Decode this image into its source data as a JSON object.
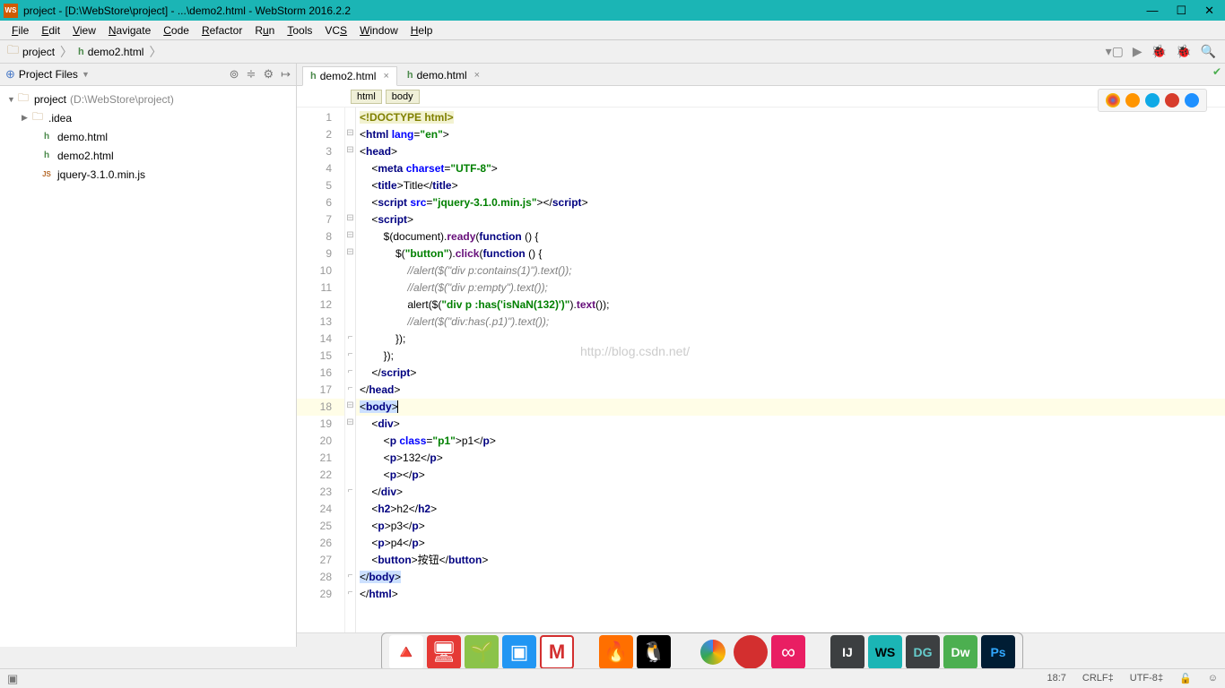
{
  "titlebar": {
    "text": "project - [D:\\WebStore\\project] - ...\\demo2.html - WebStorm 2016.2.2"
  },
  "menus": [
    "File",
    "Edit",
    "View",
    "Navigate",
    "Code",
    "Refactor",
    "Run",
    "Tools",
    "VCS",
    "Window",
    "Help"
  ],
  "breadcrumb": {
    "folder": "project",
    "file": "demo2.html"
  },
  "project_panel": {
    "title": "Project Files",
    "root": "project",
    "root_path": "(D:\\WebStore\\project)",
    "idea": ".idea",
    "files": [
      "demo.html",
      "demo2.html",
      "jquery-3.1.0.min.js"
    ]
  },
  "editor_tabs": [
    {
      "name": "demo2.html",
      "active": true
    },
    {
      "name": "demo.html",
      "active": false
    }
  ],
  "crumbs": [
    "html",
    "body"
  ],
  "code_lines": [
    {
      "n": 1,
      "html": "<span class='doct'>&lt;!DOCTYPE html&gt;</span>"
    },
    {
      "n": 2,
      "html": "&lt;<span class='tag'>html</span> <span class='attr'>lang</span>=<span class='val'>\"en\"</span>&gt;"
    },
    {
      "n": 3,
      "html": "&lt;<span class='tag'>head</span>&gt;"
    },
    {
      "n": 4,
      "html": "    &lt;<span class='tag'>meta</span> <span class='attr'>charset</span>=<span class='val'>\"UTF-8\"</span>&gt;"
    },
    {
      "n": 5,
      "html": "    &lt;<span class='tag'>title</span>&gt;Title&lt;/<span class='tag'>title</span>&gt;"
    },
    {
      "n": 6,
      "html": "    &lt;<span class='tag'>script</span> <span class='attr'>src</span>=<span class='val'>\"jquery-3.1.0.min.js\"</span>&gt;&lt;/<span class='tag'>script</span>&gt;"
    },
    {
      "n": 7,
      "html": "    &lt;<span class='tag'>script</span>&gt;"
    },
    {
      "n": 8,
      "html": "        $(document).<span class='prop'>ready</span>(<span class='kw'>function</span> () {"
    },
    {
      "n": 9,
      "html": "            $(<span class='str'>\"button\"</span>).<span class='prop'>click</span>(<span class='kw'>function</span> () {"
    },
    {
      "n": 10,
      "html": "                <span class='comm'>//alert($(\"div p:contains(1)\").text());</span>"
    },
    {
      "n": 11,
      "html": "                <span class='comm'>//alert($(\"div p:empty\").text());</span>"
    },
    {
      "n": 12,
      "html": "                alert($(<span class='str'>\"div p :has('isNaN(132)')\"</span>).<span class='prop'>text</span>());"
    },
    {
      "n": 13,
      "html": "                <span class='comm'>//alert($(\"div:has(.p1)\").text());</span>"
    },
    {
      "n": 14,
      "html": "            });"
    },
    {
      "n": 15,
      "html": "        });"
    },
    {
      "n": 16,
      "html": "    &lt;/<span class='tag'>script</span>&gt;"
    },
    {
      "n": 17,
      "html": "&lt;/<span class='tag'>head</span>&gt;"
    },
    {
      "n": 18,
      "html": "<span class='body-hl'>&lt;<span class='tag'>body</span>&gt;</span><span class='caret'></span>"
    },
    {
      "n": 19,
      "html": "    &lt;<span class='tag'>div</span>&gt;"
    },
    {
      "n": 20,
      "html": "        &lt;<span class='tag'>p</span> <span class='attr'>class</span>=<span class='val'>\"p1\"</span>&gt;p1&lt;/<span class='tag'>p</span>&gt;"
    },
    {
      "n": 21,
      "html": "        &lt;<span class='tag'>p</span>&gt;132&lt;/<span class='tag'>p</span>&gt;"
    },
    {
      "n": 22,
      "html": "        &lt;<span class='tag'>p</span>&gt;&lt;/<span class='tag'>p</span>&gt;"
    },
    {
      "n": 23,
      "html": "    &lt;/<span class='tag'>div</span>&gt;"
    },
    {
      "n": 24,
      "html": "    &lt;<span class='tag'>h2</span>&gt;h2&lt;/<span class='tag'>h2</span>&gt;"
    },
    {
      "n": 25,
      "html": "    &lt;<span class='tag'>p</span>&gt;p3&lt;/<span class='tag'>p</span>&gt;"
    },
    {
      "n": 26,
      "html": "    &lt;<span class='tag'>p</span>&gt;p4&lt;/<span class='tag'>p</span>&gt;"
    },
    {
      "n": 27,
      "html": "    &lt;<span class='tag'>button</span>&gt;按钮&lt;/<span class='tag'>button</span>&gt;"
    },
    {
      "n": 28,
      "html": "<span class='body-hl'>&lt;/<span class='tag'>body</span>&gt;</span>"
    },
    {
      "n": 29,
      "html": "&lt;/<span class='tag'>html</span>&gt;"
    }
  ],
  "watermark": "http://blog.csdn.net/",
  "current_line": 18,
  "statusbar": {
    "pos": "18:7",
    "lineend": "CRLF",
    "encoding": "UTF-8"
  }
}
